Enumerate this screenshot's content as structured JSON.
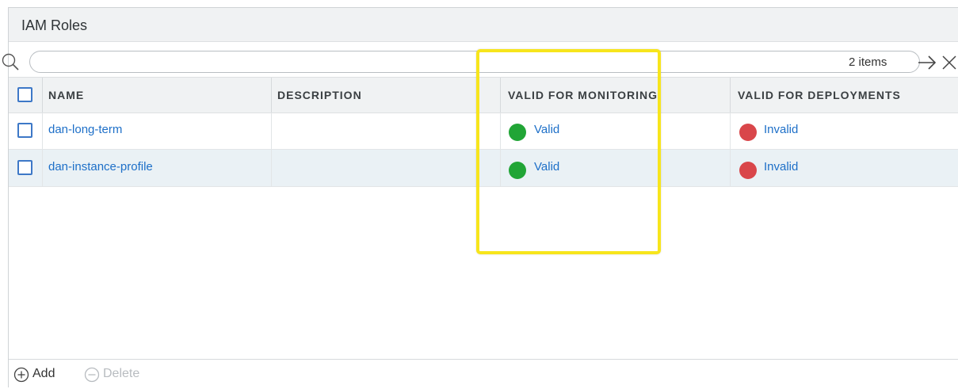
{
  "panel": {
    "title": "IAM Roles"
  },
  "search": {
    "value": "",
    "placeholder": "",
    "count_label": "2 items"
  },
  "table": {
    "columns": [
      "NAME",
      "DESCRIPTION",
      "VALID FOR MONITORING",
      "VALID FOR DEPLOYMENTS"
    ],
    "rows": [
      {
        "name": "dan-long-term",
        "description": "",
        "monitoring": "Valid",
        "deployments": "Invalid"
      },
      {
        "name": "dan-instance-profile",
        "description": "",
        "monitoring": "Valid",
        "deployments": "Invalid"
      }
    ]
  },
  "footer": {
    "add_label": "Add",
    "delete_label": "Delete"
  },
  "colors": {
    "link": "#1d6fc8",
    "valid": "#21a536",
    "invalid": "#d9464a",
    "highlight": "#f7e51c",
    "checkbox": "#3d78c7"
  }
}
